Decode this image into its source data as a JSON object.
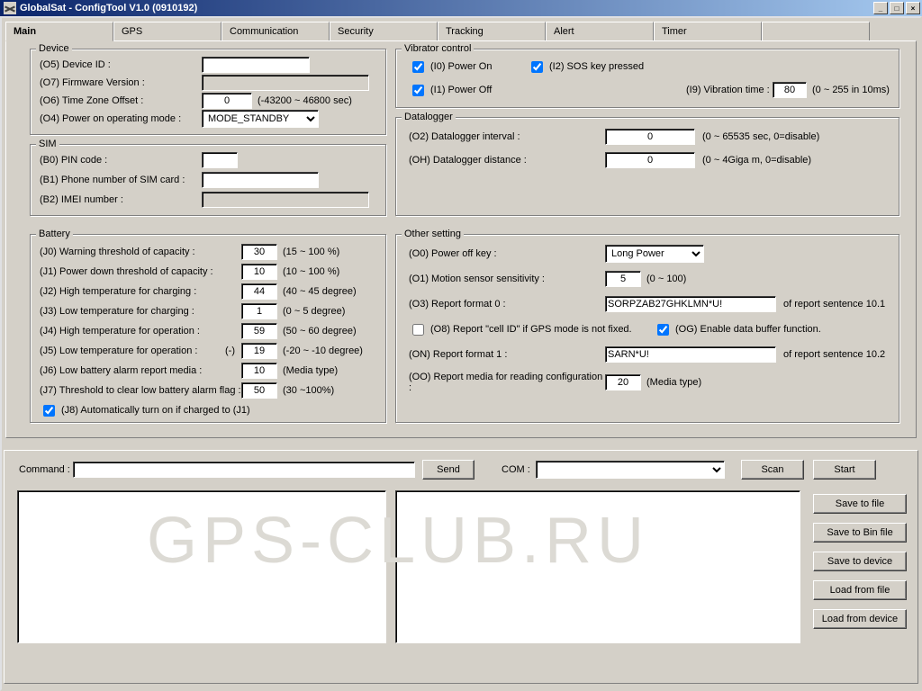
{
  "window": {
    "title": "GlobalSat - ConfigTool V1.0 (0910192)"
  },
  "tabs": [
    "Main",
    "GPS",
    "Communication",
    "Security",
    "Tracking",
    "Alert",
    "Timer"
  ],
  "device": {
    "legend": "Device",
    "id_label": "(O5) Device ID :",
    "id_value": "",
    "fw_label": "(O7) Firmware Version :",
    "fw_value": "",
    "tz_label": "(O6) Time Zone Offset :",
    "tz_value": "0",
    "tz_hint": "(-43200 ~ 46800 sec)",
    "mode_label": "(O4) Power on operating mode :",
    "mode_value": "MODE_STANDBY"
  },
  "sim": {
    "legend": "SIM",
    "pin_label": "(B0) PIN code :",
    "pin_value": "",
    "phone_label": "(B1) Phone number of SIM card :",
    "phone_value": "",
    "imei_label": "(B2) IMEI number :",
    "imei_value": ""
  },
  "battery": {
    "legend": "Battery",
    "j0_label": "(J0) Warning threshold of capacity :",
    "j0_value": "30",
    "j0_hint": "(15 ~ 100 %)",
    "j1_label": "(J1) Power down threshold of capacity :",
    "j1_value": "10",
    "j1_hint": "(10 ~ 100 %)",
    "j2_label": "(J2) High temperature for charging :",
    "j2_value": "44",
    "j2_hint": "(40 ~ 45 degree)",
    "j3_label": "(J3) Low temperature for charging :",
    "j3_value": "1",
    "j3_hint": "(0 ~ 5 degree)",
    "j4_label": "(J4) High temperature for operation :",
    "j4_value": "59",
    "j4_hint": "(50 ~ 60 degree)",
    "j5_label": "(J5) Low temperature for operation :",
    "j5_neg": "(-)",
    "j5_value": "19",
    "j5_hint": "(-20 ~ -10 degree)",
    "j6_label": "(J6) Low battery alarm report media :",
    "j6_value": "10",
    "j6_hint": "(Media type)",
    "j7_label": "(J7) Threshold to clear low battery alarm flag :",
    "j7_value": "50",
    "j7_hint": "(30 ~100%)",
    "j8_label": "(J8) Automatically turn on if charged to (J1)"
  },
  "vibrator": {
    "legend": "Vibrator control",
    "i0_label": "(I0) Power On",
    "i2_label": "(I2) SOS key pressed",
    "i1_label": "(I1) Power Off",
    "i9_label": "(I9) Vibration time :",
    "i9_value": "80",
    "i9_hint": "(0 ~  255  in 10ms)"
  },
  "datalogger": {
    "legend": "Datalogger",
    "o2_label": "(O2) Datalogger interval :",
    "o2_value": "0",
    "o2_hint": "(0 ~ 65535 sec, 0=disable)",
    "oh_label": "(OH) Datalogger distance :",
    "oh_value": "0",
    "oh_hint": "(0 ~ 4Giga m, 0=disable)"
  },
  "other": {
    "legend": "Other setting",
    "o0_label": "(O0) Power off key :",
    "o0_value": "Long Power",
    "o1_label": "(O1) Motion sensor sensitivity :",
    "o1_value": "5",
    "o1_hint": "(0 ~ 100)",
    "o3_label": "(O3) Report format 0 :",
    "o3_value": "SORPZAB27GHKLMN*U!",
    "o3_hint": "of report sentence 10.1",
    "o8_label": "(O8) Report \"cell ID\" if GPS mode is not fixed.",
    "og_label": "(OG) Enable data buffer function.",
    "on_label": "(ON) Report format 1 :",
    "on_value": "SARN*U!",
    "on_hint": "of report sentence 10.2",
    "oo_label": "(OO) Report media for reading configuration :",
    "oo_value": "20",
    "oo_hint": "(Media type)"
  },
  "bottom": {
    "command_label": "Command :",
    "command_value": "",
    "send_label": "Send",
    "com_label": "COM :",
    "com_value": "",
    "scan_label": "Scan",
    "start_label": "Start",
    "btn_save_file": "Save to file",
    "btn_save_bin": "Save to Bin file",
    "btn_save_device": "Save to device",
    "btn_load_file": "Load from file",
    "btn_load_device": "Load from device",
    "watermark": "GPS-CLUB.RU"
  }
}
